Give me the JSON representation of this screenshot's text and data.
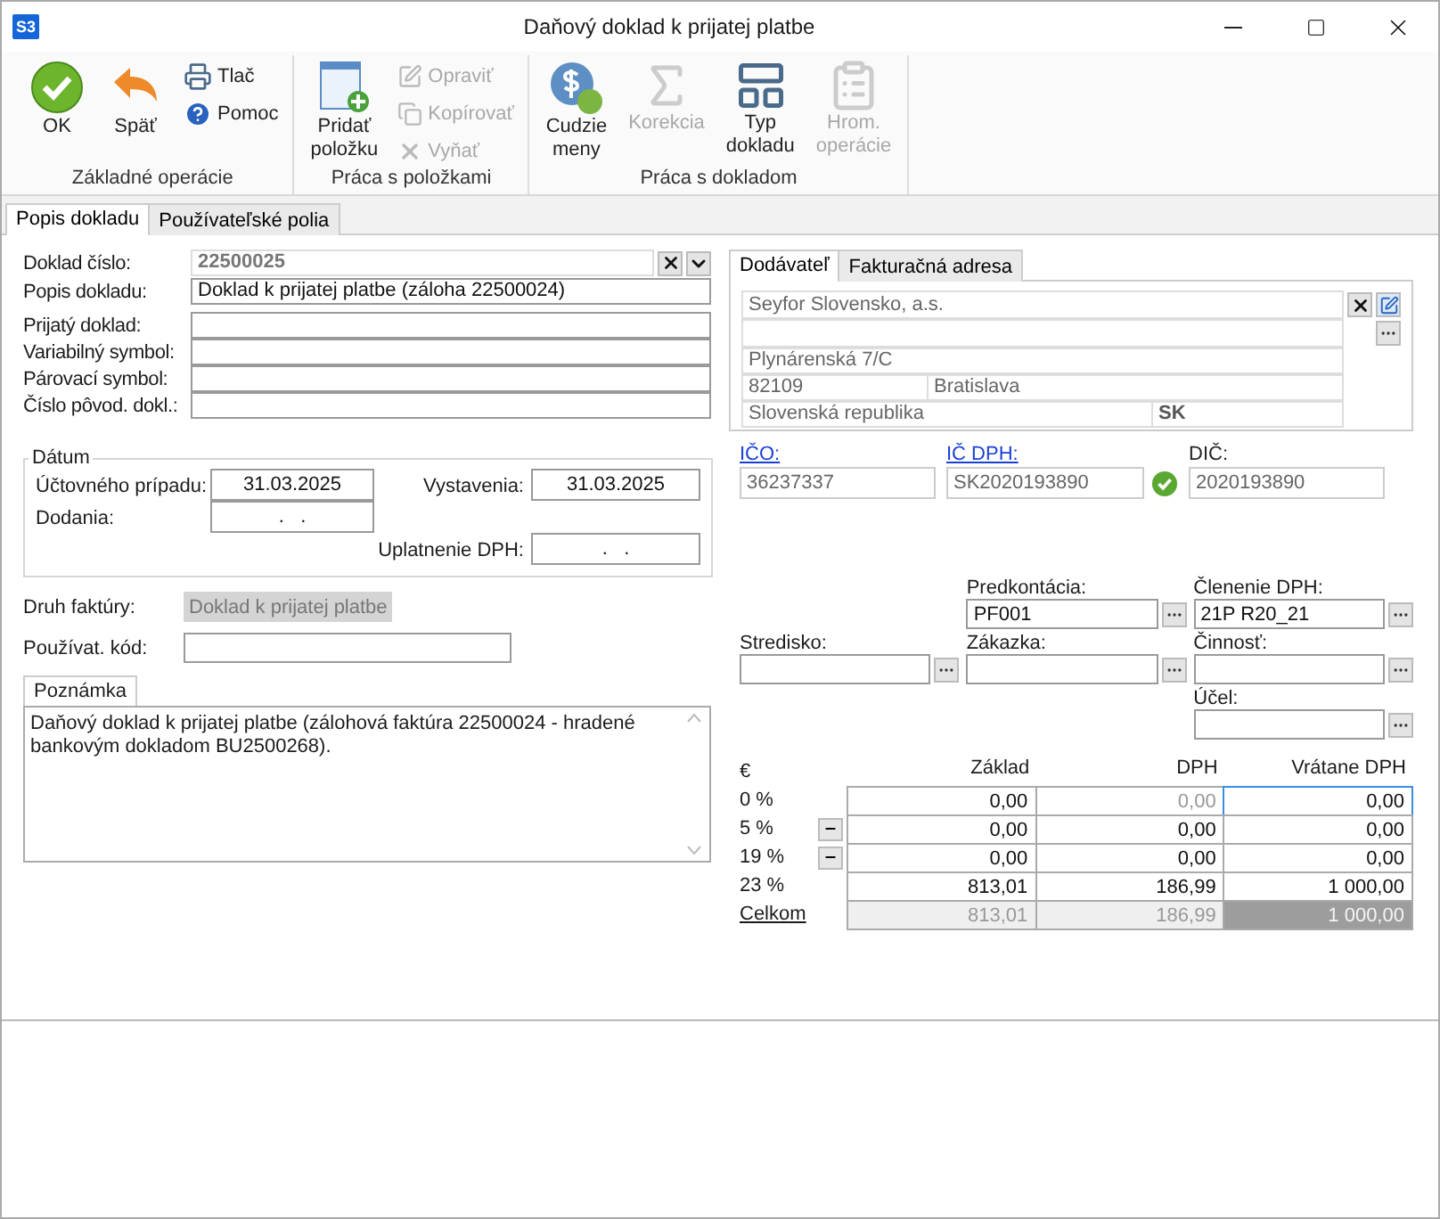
{
  "window": {
    "logo": "S3",
    "title": "Daňový doklad k prijatej platbe"
  },
  "ribbon": {
    "groups": [
      {
        "label": "Základné operácie",
        "items": [
          {
            "label": "OK",
            "kind": "large",
            "disabled": false
          },
          {
            "label": "Späť",
            "kind": "large",
            "disabled": false
          },
          {
            "label": "Tlač",
            "kind": "small",
            "disabled": false
          },
          {
            "label": "Pomoc",
            "kind": "small",
            "disabled": false
          }
        ]
      },
      {
        "label": "Práca s položkami",
        "items": [
          {
            "label": "Pridať\npoložku",
            "kind": "large",
            "disabled": false
          },
          {
            "label": "Opraviť",
            "kind": "small",
            "disabled": true
          },
          {
            "label": "Kopírovať",
            "kind": "small",
            "disabled": true
          },
          {
            "label": "Vyňať",
            "kind": "small",
            "disabled": true
          }
        ]
      },
      {
        "label": "Práca s dokladom",
        "items": [
          {
            "label": "Cudzie\nmeny",
            "kind": "large",
            "disabled": false
          },
          {
            "label": "Korekcia",
            "kind": "large",
            "disabled": true
          },
          {
            "label": "Typ\ndokladu",
            "kind": "large",
            "disabled": false
          },
          {
            "label": "Hrom.\noperácie",
            "kind": "large",
            "disabled": true
          }
        ]
      }
    ]
  },
  "tabs": [
    {
      "label": "Popis dokladu",
      "selected": true
    },
    {
      "label": "Používateľské polia",
      "selected": false
    }
  ],
  "document": {
    "fields": [
      {
        "label": "Doklad číslo:",
        "value": "22500025",
        "kind": "number"
      },
      {
        "label": "Popis dokladu:",
        "value": "Doklad k prijatej platbe (záloha 22500024)",
        "kind": "text"
      },
      {
        "label": "Prijatý doklad:",
        "kind": "text"
      },
      {
        "label": "Variabilný symbol:",
        "kind": "text"
      },
      {
        "label": "Párovací symbol:",
        "kind": "text"
      },
      {
        "label": "Číslo pôvod. dokl.:",
        "kind": "text"
      }
    ]
  },
  "dates": {
    "title": "Dátum",
    "fields": [
      {
        "label": "Účtovného prípadu:",
        "value": "31.03.2025"
      },
      {
        "label": "Dodania:",
        "value": ".   ."
      },
      {
        "label": "Vystavenia:",
        "value": "31.03.2025"
      },
      {
        "label": "Uplatnenie DPH:",
        "value": ".   ."
      }
    ]
  },
  "invoice_type": {
    "label": "Druh faktúry:",
    "value": "Doklad k prijatej platbe",
    "disabled": true
  },
  "user_code": {
    "label": "Používat. kód:"
  },
  "note": {
    "tab": "Poznámka",
    "text": "Daňový doklad k prijatej platbe (zálohová faktúra 22500024 - hradené bankovým dokladom BU2500268)."
  },
  "supplier": {
    "tabs": [
      {
        "label": "Dodávateľ",
        "selected": true
      },
      {
        "label": "Fakturačná adresa",
        "selected": false
      }
    ],
    "name": "Seyfor Slovensko, a.s.",
    "street": "Plynárenská 7/C",
    "zip": "82109",
    "city": "Bratislava",
    "country": "Slovenská republika",
    "country_code": "SK"
  },
  "ids": [
    {
      "label": "IČO:",
      "value": "36237337",
      "link": true,
      "verified": false
    },
    {
      "label": "IČ DPH:",
      "value": "SK2020193890",
      "link": true,
      "verified": true
    },
    {
      "label": "DIČ:",
      "value": "2020193890",
      "link": false,
      "verified": false
    }
  ],
  "accounting": {
    "rows": [
      [
        null,
        {
          "label": "Predkontácia:",
          "value": "PF001"
        },
        {
          "label": "Členenie DPH:",
          "value": "21P R20_21"
        }
      ],
      [
        {
          "label": "Stredisko:"
        },
        {
          "label": "Zákazka:"
        },
        {
          "label": "Činnosť:"
        }
      ],
      [
        null,
        null,
        {
          "label": "Účel:"
        }
      ]
    ]
  },
  "totals": {
    "currency": "€",
    "columns": [
      "Základ",
      "DPH",
      "Vrátane DPH"
    ],
    "rows": [
      {
        "label": "0 %",
        "kind": "rate",
        "collapse_button": false,
        "cells": [
          {
            "value": "0,00",
            "disabled": false,
            "focused": false
          },
          {
            "value": "0,00",
            "disabled": true,
            "focused": false
          },
          {
            "value": "0,00",
            "disabled": false,
            "focused": true
          }
        ]
      },
      {
        "label": "5 %",
        "kind": "rate",
        "collapse_button": true,
        "cells": [
          {
            "value": "0,00",
            "disabled": false,
            "focused": false
          },
          {
            "value": "0,00",
            "disabled": false,
            "focused": false
          },
          {
            "value": "0,00",
            "disabled": false,
            "focused": false
          }
        ]
      },
      {
        "label": "19 %",
        "kind": "rate",
        "collapse_button": true,
        "cells": [
          {
            "value": "0,00",
            "disabled": false,
            "focused": false
          },
          {
            "value": "0,00",
            "disabled": false,
            "focused": false
          },
          {
            "value": "0,00",
            "disabled": false,
            "focused": false
          }
        ]
      },
      {
        "label": "23 %",
        "kind": "rate",
        "collapse_button": false,
        "cells": [
          {
            "value": "813,01",
            "disabled": false,
            "focused": false
          },
          {
            "value": "186,99",
            "disabled": false,
            "focused": false
          },
          {
            "value": "1 000,00",
            "disabled": false,
            "focused": false
          }
        ]
      },
      {
        "label": "Celkom",
        "kind": "total",
        "collapse_button": false,
        "cells": [
          {
            "value": "813,01",
            "disabled": true,
            "focused": false
          },
          {
            "value": "186,99",
            "disabled": true,
            "focused": false
          },
          {
            "value": "1 000,00",
            "disabled": true,
            "focused": false
          }
        ]
      }
    ]
  }
}
